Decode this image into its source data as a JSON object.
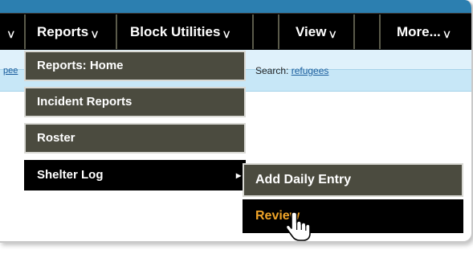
{
  "nav": {
    "partial_arrow": "ᐯ",
    "reports_label": "Reports",
    "block_utilities_label": "Block Utilities",
    "view_label": "View",
    "more_label": "More...",
    "arrow_glyph": "ᐯ"
  },
  "strip": {
    "left_link": "pee",
    "search_label": "Search:",
    "search_value": "refugees"
  },
  "reports_menu": {
    "items": [
      {
        "label": "Reports: Home"
      },
      {
        "label": "Incident Reports"
      },
      {
        "label": "Roster"
      },
      {
        "label": "Shelter Log",
        "submenu_glyph": "▸"
      }
    ]
  },
  "shelter_log_menu": {
    "items": [
      {
        "label": "Add Daily Entry"
      },
      {
        "label": "Review"
      }
    ]
  },
  "colors": {
    "nav_bg": "#000000",
    "menu_bg": "#4b4b3f",
    "active_text": "#f0a429",
    "strip_bg": "#dff1fb"
  },
  "icons": {
    "cursor": "hand-pointer-icon"
  }
}
